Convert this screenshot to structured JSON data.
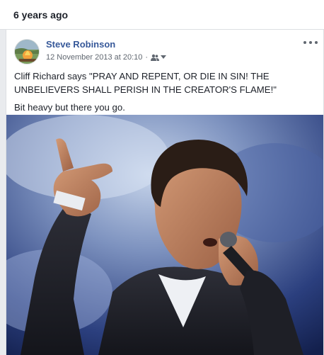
{
  "memory": {
    "title": "6 years ago"
  },
  "post": {
    "author": "Steve Robinson",
    "timestamp": "12 November 2013 at 20:10",
    "separator": "·",
    "audience_icon": "friends-icon",
    "text_lines": [
      "Cliff Richard says \"PRAY AND REPENT, OR DIE IN SIN! THE UNBELIEVERS SHALL PERISH IN THE CREATOR'S FLAME!\"",
      "Bit heavy but there you go."
    ]
  },
  "colors": {
    "link_blue": "#365899",
    "text": "#1d2129",
    "meta": "#606770",
    "border": "#dddfe2"
  }
}
